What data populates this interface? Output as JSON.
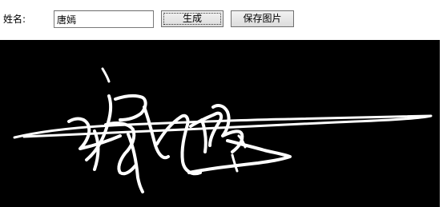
{
  "form": {
    "name_label": "姓名:",
    "name_value": "唐嫣",
    "generate_label": "生成",
    "save_label": "保存图片"
  },
  "signature": {
    "background": "#000000",
    "stroke_color": "#ffffff"
  }
}
